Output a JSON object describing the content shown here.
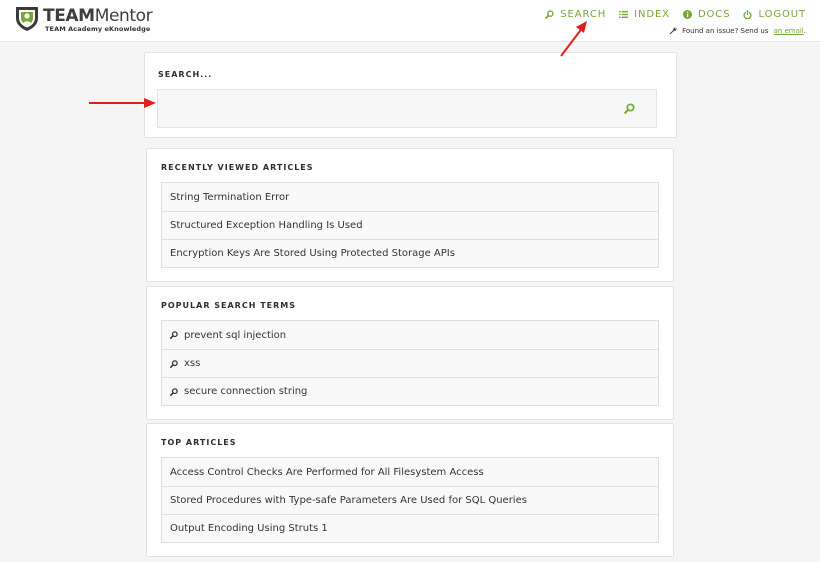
{
  "brand": {
    "name_bold": "TEAM",
    "name_light": "Mentor",
    "tagline": "TEAM Academy eKnowledge"
  },
  "nav": {
    "items": [
      {
        "label": "SEARCH",
        "icon": "search-icon"
      },
      {
        "label": "INDEX",
        "icon": "list-icon"
      },
      {
        "label": "DOCS",
        "icon": "info-icon"
      },
      {
        "label": "LOGOUT",
        "icon": "power-icon"
      }
    ]
  },
  "issue": {
    "text": "Found an issue? Send us",
    "link": "an email",
    "suffix": ".",
    "icon": "wrench-icon"
  },
  "search": {
    "heading": "SEARCH...",
    "value": "",
    "placeholder": ""
  },
  "recent": {
    "heading": "RECENTLY VIEWED ARTICLES",
    "items": [
      "String Termination Error",
      "Structured Exception Handling Is Used",
      "Encryption Keys Are Stored Using Protected Storage APIs"
    ]
  },
  "popular": {
    "heading": "POPULAR SEARCH TERMS",
    "items": [
      "prevent sql injection",
      "xss",
      "secure connection string"
    ]
  },
  "top": {
    "heading": "TOP ARTICLES",
    "items": [
      "Access Control Checks Are Performed for All Filesystem Access",
      "Stored Procedures with Type-safe Parameters Are Used for SQL Queries",
      "Output Encoding Using Struts 1"
    ]
  },
  "colors": {
    "accent": "#74a837",
    "annotation_arrow": "#e0201b"
  }
}
